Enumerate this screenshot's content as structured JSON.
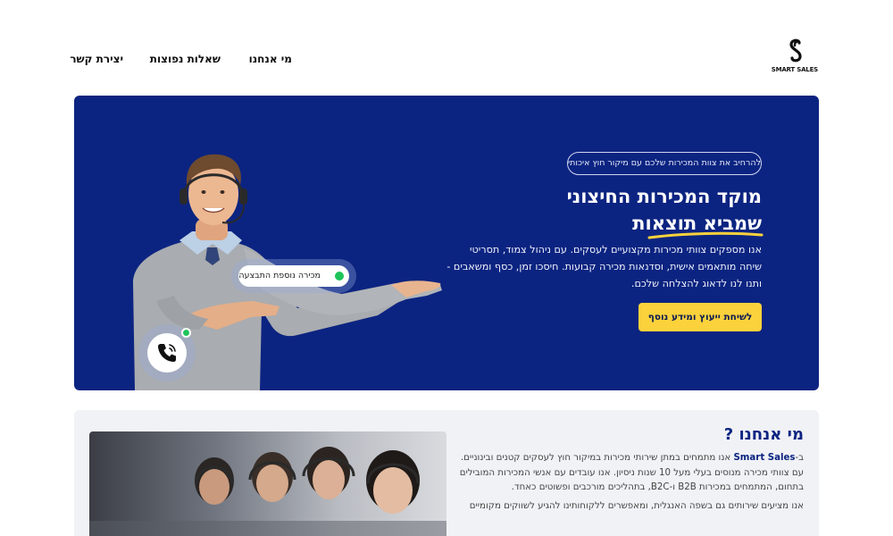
{
  "brand": {
    "name": "SMART SALES"
  },
  "nav": {
    "items": [
      {
        "label": "מי אנחנו"
      },
      {
        "label": "שאלות נפוצות"
      },
      {
        "label": "יצירת קשר"
      }
    ]
  },
  "hero": {
    "tagline": "להרחיב את צוות המכירות שלכם עם מיקור חוץ איכותי",
    "title_line1": "מוקד המכירות החיצוני",
    "title_line2": "שמביא תוצאות",
    "paragraph": "אנו מספקים צוותי מכירות מקצועיים לעסקים. עם ניהול צמוד, תסריטי שיחה מותאמים אישית, וסדנאות מכירה קבועות. חיסכו זמן, כסף ומשאבים - ותנו לנו לדאוג להצלחה שלכם.",
    "cta_label": "לשיחת ייעוץ ומידע נוסף",
    "badge_label": "מכירה נוספת התבצעה"
  },
  "about": {
    "title": "מי אנחנו ?",
    "prefix": "ב-",
    "brand_inline": "Smart Sales",
    "para1_rest": " אנו מתמחים במתן שירותי מכירות במיקור חוץ לעסקים קטנים ובינוניים. עם צוותי מכירה מנוסים בעלי מעל 10 שנות ניסיון. אנו עובדים עם אנשי המכירות המובילים בתחום, המתמחים במכירות B2B ו-B2C, בתהליכים מורכבים ופשוטים כאחד.",
    "para2": "אנו מציעים שירותים גם בשפה האנגלית, ומאפשרים ללקוחותינו להגיע לשווקים מקומיים"
  },
  "colors": {
    "hero_bg": "#0c2481",
    "accent": "#fbd23b",
    "status_green": "#1ec45a",
    "section_bg": "#f1f2f6"
  },
  "icons": {
    "logo": "s-logo-icon",
    "phone": "phone-icon"
  }
}
